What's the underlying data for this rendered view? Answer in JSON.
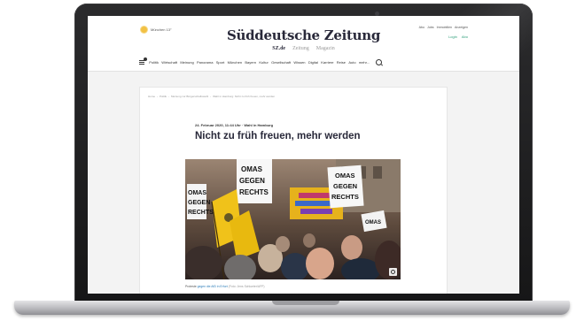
{
  "header": {
    "weather": "München 13°",
    "logo": "Süddeutsche Zeitung",
    "brands": [
      "SZ.de",
      "Zeitung",
      "Magazin"
    ],
    "top_links": [
      "Abo",
      "Jobs",
      "Immobilien",
      "Anzeigen"
    ],
    "account_links": [
      "Login",
      "Abo"
    ]
  },
  "nav": {
    "items": [
      "Politik",
      "Wirtschaft",
      "Meinung",
      "Panorama",
      "Sport",
      "München",
      "Bayern",
      "Kultur",
      "Gesellschaft",
      "Wissen",
      "Digital",
      "Karriere",
      "Reise",
      "Auto",
      "mehr..."
    ]
  },
  "article": {
    "breadcrumb": [
      "Home",
      "Politik",
      "Meinung zur Bürgerschaftswahl",
      "Wahl in Hamburg: Nicht zu früh freuen, mehr werden"
    ],
    "meta": "24. Februar 2020, 11:44 Uhr · Wahl in Hamburg",
    "headline": "Nicht zu früh freuen, mehr werden",
    "photo": {
      "signs": [
        {
          "lines": [
            "OMAS",
            "GEGEN",
            "RECHTS"
          ]
        },
        {
          "lines": [
            "OMAS",
            "GEGEN",
            "RECHTS"
          ]
        },
        {
          "lines": [
            "OMAS",
            "GEGEN",
            "RECHTS"
          ]
        },
        {
          "lines": [
            "OMAS"
          ]
        }
      ]
    },
    "caption": {
      "prefix": "Proteste",
      "link": "gegen die AfD in Erfurt",
      "credit": "(Foto: Jens Schlueter/AFP)"
    }
  },
  "colors": {
    "brand_dark": "#29293a",
    "accent_green": "#2e9f7a",
    "flag_yellow": "#f0c21a"
  }
}
